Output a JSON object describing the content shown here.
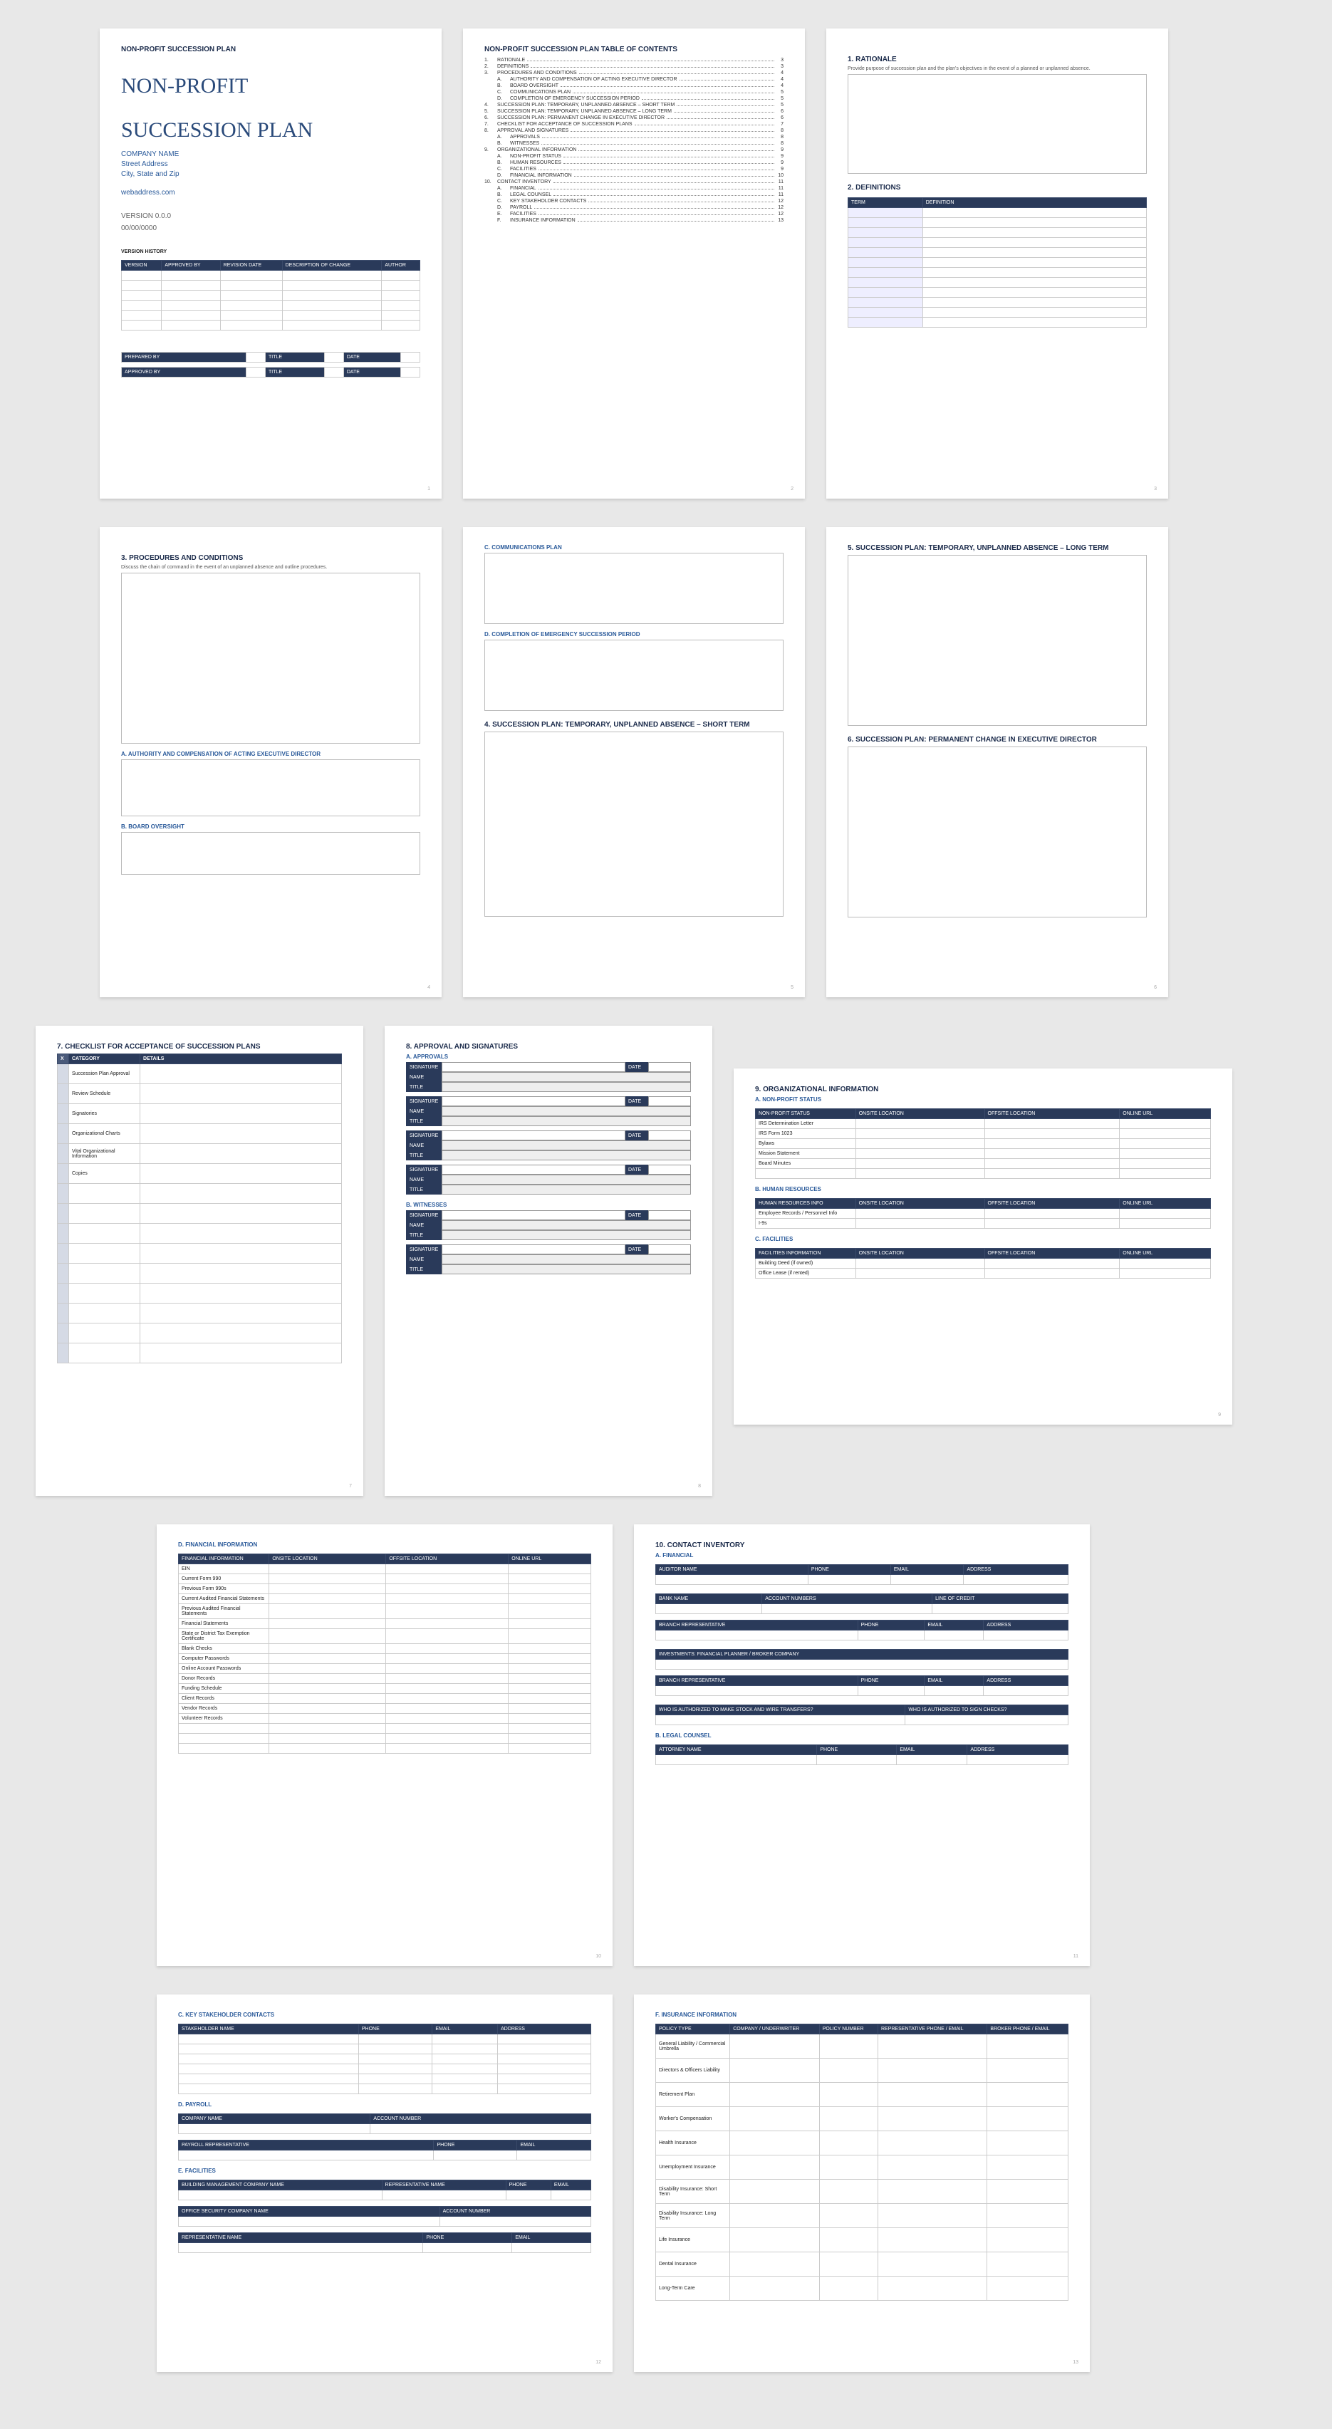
{
  "doc_header": "NON-PROFIT SUCCESSION PLAN",
  "page1": {
    "title1": "NON-PROFIT",
    "title2": "SUCCESSION PLAN",
    "company": "COMPANY NAME",
    "address": "Street Address",
    "citystate": "City, State and Zip",
    "web": "webaddress.com",
    "version": "VERSION 0.0.0",
    "date": "00/00/0000",
    "vh_title": "VERSION HISTORY",
    "vh_cols": [
      "VERSION",
      "APPROVED BY",
      "REVISION DATE",
      "DESCRIPTION OF CHANGE",
      "AUTHOR"
    ],
    "foot": [
      "PREPARED BY",
      "TITLE",
      "DATE",
      "APPROVED BY",
      "TITLE",
      "DATE"
    ]
  },
  "page2": {
    "title": "NON-PROFIT SUCCESSION PLAN TABLE OF CONTENTS",
    "items": [
      {
        "n": "1.",
        "t": "RATIONALE",
        "p": "3"
      },
      {
        "n": "2.",
        "t": "DEFINITIONS",
        "p": "3"
      },
      {
        "n": "3.",
        "t": "PROCEDURES AND CONDITIONS",
        "p": "4"
      },
      {
        "n": "A.",
        "t": "AUTHORITY AND COMPENSATION OF ACTING EXECUTIVE DIRECTOR",
        "p": "4",
        "sub": true
      },
      {
        "n": "B.",
        "t": "BOARD OVERSIGHT",
        "p": "4",
        "sub": true
      },
      {
        "n": "C.",
        "t": "COMMUNICATIONS PLAN",
        "p": "5",
        "sub": true
      },
      {
        "n": "D.",
        "t": "COMPLETION OF EMERGENCY SUCCESSION PERIOD",
        "p": "5",
        "sub": true
      },
      {
        "n": "4.",
        "t": "SUCCESSION PLAN: TEMPORARY, UNPLANNED ABSENCE – SHORT TERM",
        "p": "5"
      },
      {
        "n": "5.",
        "t": "SUCCESSION PLAN: TEMPORARY, UNPLANNED ABSENCE – LONG TERM",
        "p": "6"
      },
      {
        "n": "6.",
        "t": "SUCCESSION PLAN: PERMANENT CHANGE IN EXECUTIVE DIRECTOR",
        "p": "6"
      },
      {
        "n": "7.",
        "t": "CHECKLIST FOR ACCEPTANCE OF SUCCESSION PLANS",
        "p": "7"
      },
      {
        "n": "8.",
        "t": "APPROVAL AND SIGNATURES",
        "p": "8"
      },
      {
        "n": "A.",
        "t": "APPROVALS",
        "p": "8",
        "sub": true
      },
      {
        "n": "B.",
        "t": "WITNESSES",
        "p": "8",
        "sub": true
      },
      {
        "n": "9.",
        "t": "ORGANIZATIONAL INFORMATION",
        "p": "9"
      },
      {
        "n": "A.",
        "t": "NON-PROFIT STATUS",
        "p": "9",
        "sub": true
      },
      {
        "n": "B.",
        "t": "HUMAN RESOURCES",
        "p": "9",
        "sub": true
      },
      {
        "n": "C.",
        "t": "FACILITIES",
        "p": "9",
        "sub": true
      },
      {
        "n": "D.",
        "t": "FINANCIAL INFORMATION",
        "p": "10",
        "sub": true
      },
      {
        "n": "10.",
        "t": "CONTACT INVENTORY",
        "p": "11"
      },
      {
        "n": "A.",
        "t": "FINANCIAL",
        "p": "11",
        "sub": true
      },
      {
        "n": "B.",
        "t": "LEGAL COUNSEL",
        "p": "11",
        "sub": true
      },
      {
        "n": "C.",
        "t": "KEY STAKEHOLDER CONTACTS",
        "p": "12",
        "sub": true
      },
      {
        "n": "D.",
        "t": "PAYROLL",
        "p": "12",
        "sub": true
      },
      {
        "n": "E.",
        "t": "FACILITIES",
        "p": "12",
        "sub": true
      },
      {
        "n": "F.",
        "t": "INSURANCE INFORMATION",
        "p": "13",
        "sub": true
      }
    ]
  },
  "page3": {
    "s1": "1.  RATIONALE",
    "s1d": "Provide purpose of succession plan and the plan's objectives in the event of a planned or unplanned absence.",
    "s2": "2.  DEFINITIONS",
    "cols": [
      "TERM",
      "DEFINITION"
    ]
  },
  "page4": {
    "s3": "3.  PROCEDURES AND CONDITIONS",
    "s3d": "Discuss the chain of command in the event of an unplanned absence and outline procedures.",
    "a": "A.  AUTHORITY AND COMPENSATION OF ACTING EXECUTIVE DIRECTOR",
    "b": "B.  BOARD OVERSIGHT"
  },
  "page5": {
    "c": "C.  COMMUNICATIONS PLAN",
    "d": "D.  COMPLETION OF EMERGENCY SUCCESSION PERIOD",
    "s4": "4.  SUCCESSION PLAN: TEMPORARY, UNPLANNED ABSENCE – SHORT TERM"
  },
  "page6": {
    "s5": "5.  SUCCESSION PLAN: TEMPORARY, UNPLANNED ABSENCE – LONG TERM",
    "s6": "6.  SUCCESSION PLAN: PERMANENT CHANGE IN EXECUTIVE DIRECTOR"
  },
  "page7": {
    "title": "7.  CHECKLIST FOR ACCEPTANCE OF SUCCESSION PLANS",
    "cols": [
      "X",
      "CATEGORY",
      "DETAILS"
    ],
    "rows": [
      "Succession Plan Approval",
      "Review Schedule",
      "Signatories",
      "Organizational Charts",
      "Vital Organizational Information",
      "Copies",
      "",
      "",
      "",
      "",
      "",
      "",
      "",
      "",
      ""
    ]
  },
  "page8": {
    "title": "8.  APPROVAL AND SIGNATURES",
    "a": "A.  APPROVALS",
    "b": "B.  WITNESSES",
    "lbls": {
      "sig": "SIGNATURE",
      "name": "NAME",
      "tit": "TITLE",
      "date": "DATE"
    }
  },
  "page9": {
    "title": "9.  ORGANIZATIONAL INFORMATION",
    "a": "A.  NON-PROFIT STATUS",
    "a_cols": [
      "NON-PROFIT STATUS",
      "ONSITE LOCATION",
      "OFFSITE LOCATION",
      "ONLINE URL"
    ],
    "a_rows": [
      "IRS Determination Letter",
      "IRS Form 1023",
      "Bylaws",
      "Mission Statement",
      "Board Minutes",
      ""
    ],
    "b": "B.  HUMAN RESOURCES",
    "b_cols": [
      "HUMAN RESOURCES INFO",
      "ONSITE LOCATION",
      "OFFSITE LOCATION",
      "ONLINE URL"
    ],
    "b_rows": [
      "Employee Records / Personnel Info",
      "I-9s"
    ],
    "c": "C.  FACILITIES",
    "c_cols": [
      "FACILITIES INFORMATION",
      "ONSITE LOCATION",
      "OFFSITE LOCATION",
      "ONLINE URL"
    ],
    "c_rows": [
      "Building Deed (if owned)",
      "Office Lease (if rented)"
    ]
  },
  "page10": {
    "d": "D.  FINANCIAL INFORMATION",
    "cols": [
      "FINANCIAL INFORMATION",
      "ONSITE LOCATION",
      "OFFSITE LOCATION",
      "ONLINE URL"
    ],
    "rows": [
      "EIN",
      "Current Form 990",
      "Previous Form 990s",
      "Current Audited Financial Statements",
      "Previous Audited Financial Statements",
      "Financial Statements",
      "State or District Tax Exemption Certificate",
      "Blank Checks",
      "Computer Passwords",
      "Online Account Passwords",
      "Donor Records",
      "Funding Schedule",
      "Client Records",
      "Vendor Records",
      "Volunteer Records",
      "",
      "",
      ""
    ]
  },
  "page11": {
    "title": "10.    CONTACT INVENTORY",
    "a": "A.  FINANCIAL",
    "t1": [
      "AUDITOR NAME",
      "PHONE",
      "EMAIL",
      "ADDRESS"
    ],
    "t2": [
      "BANK NAME",
      "ACCOUNT NUMBERS",
      "LINE OF CREDIT"
    ],
    "t3": [
      "BRANCH REPRESENTATIVE",
      "PHONE",
      "EMAIL",
      "ADDRESS"
    ],
    "t4": "INVESTMENTS: FINANCIAL PLANNER / BROKER COMPANY",
    "t5": [
      "BRANCH REPRESENTATIVE",
      "PHONE",
      "EMAIL",
      "ADDRESS"
    ],
    "t6": [
      "WHO IS AUTHORIZED TO MAKE STOCK AND WIRE TRANSFERS?",
      "WHO IS AUTHORIZED TO SIGN CHECKS?"
    ],
    "b": "B.  LEGAL COUNSEL",
    "t7": [
      "ATTORNEY NAME",
      "PHONE",
      "EMAIL",
      "ADDRESS"
    ]
  },
  "page12": {
    "c": "C.  KEY STAKEHOLDER CONTACTS",
    "t1": [
      "STAKEHOLDER NAME",
      "PHONE",
      "EMAIL",
      "ADDRESS"
    ],
    "d": "D.  PAYROLL",
    "t2": [
      "COMPANY NAME",
      "ACCOUNT NUMBER"
    ],
    "t3": [
      "PAYROLL REPRESENTATIVE",
      "PHONE",
      "EMAIL"
    ],
    "e": "E.  FACILITIES",
    "t4": [
      "BUILDING MANAGEMENT COMPANY NAME",
      "REPRESENTATIVE NAME",
      "PHONE",
      "EMAIL"
    ],
    "t5": [
      "OFFICE SECURITY COMPANY NAME",
      "ACCOUNT NUMBER"
    ],
    "t6": [
      "REPRESENTATIVE NAME",
      "PHONE",
      "EMAIL"
    ]
  },
  "page13": {
    "f": "F.  INSURANCE INFORMATION",
    "cols": [
      "POLICY TYPE",
      "COMPANY / UNDERWRITER",
      "POLICY NUMBER",
      "REPRESENTATIVE PHONE / EMAIL",
      "BROKER PHONE / EMAIL"
    ],
    "rows": [
      "General Liability / Commercial Umbrella",
      "Directors & Officers Liability",
      "Retirement Plan",
      "Worker's Compensation",
      "Health Insurance",
      "Unemployment Insurance",
      "Disability Insurance: Short Term",
      "Disability Insurance: Long Term",
      "Life Insurance",
      "Dental Insurance",
      "Long-Term Care"
    ]
  }
}
